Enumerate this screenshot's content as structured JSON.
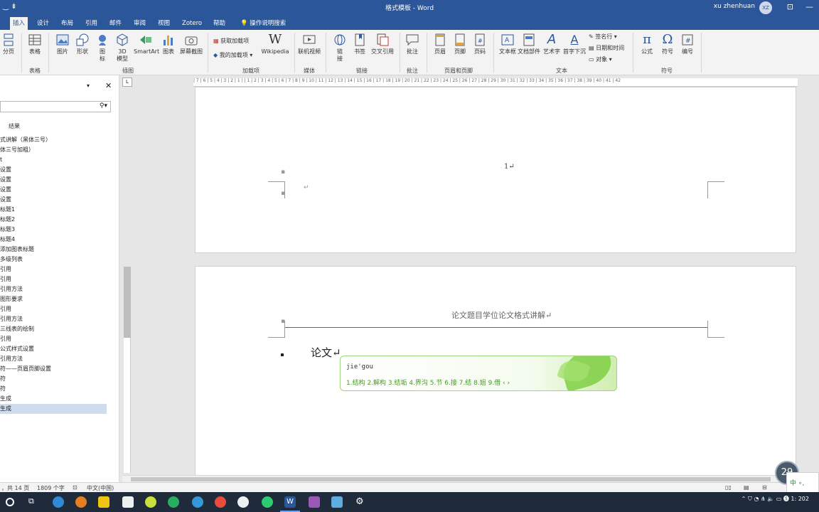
{
  "titlebar": {
    "doc_title": "格式模板  -  Word",
    "user": "xu zhenhuan",
    "avatar": "XZ",
    "save_icon": "save-icon"
  },
  "tabs": [
    "插入",
    "设计",
    "布局",
    "引用",
    "邮件",
    "审阅",
    "视图",
    "Zotero",
    "帮助",
    "操作说明搜索"
  ],
  "active_tab": "插入",
  "ribbon": {
    "buttons": {
      "page": "分页",
      "table": "表格",
      "image": "图片",
      "shape": "形状",
      "icon": "图\n标",
      "model3d": "3D\n模型",
      "smartart": "SmartArt",
      "chart": "图表",
      "screenshot": "屏幕截图",
      "get_addins": "获取加载项",
      "my_addins": "我的加载项",
      "wikipedia": "Wikipedia",
      "online_video": "联机视频",
      "link": "链\n接",
      "bookmark": "书签",
      "cross_ref": "交叉引用",
      "comment": "批注",
      "header": "页眉",
      "footer": "页脚",
      "page_number": "页码",
      "textbox": "文本框",
      "quick_parts": "文档部件",
      "wordart": "艺术字",
      "dropcap": "首字下沉",
      "signature": "签名行",
      "datetime": "日期和时间",
      "object": "对象",
      "equation": "公式",
      "symbol": "符号",
      "numbering": "编号"
    },
    "groups": {
      "tables": "表格",
      "illustrations": "插图",
      "addins": "加载项",
      "media": "媒体",
      "links": "链接",
      "comments": "批注",
      "header_footer": "页眉和页脚",
      "text": "文本",
      "symbols": "符号"
    }
  },
  "navpane": {
    "result_tab": "结果",
    "items": [
      "式讲解（黑体三号）",
      "体三号加粗）",
      "t",
      "设置",
      "设置",
      "设置",
      "设置",
      "标题1",
      "标题2",
      "标题3",
      "标题4",
      "添加图表标题",
      "多级列表",
      "引用",
      "引用",
      "引用方法",
      "图形要求",
      "引用",
      "引用方法",
      "三线表的绘制",
      "引用",
      "公式样式设置",
      "引用方法",
      "符——页眉页脚设置",
      "符",
      "符",
      "生成",
      "生成"
    ]
  },
  "ruler": {
    "numbers": "| 7 | 6 | 5 | 4 | 3 | 2 | 1 |  | 1 | 2 | 3 | 4 | 5 | 6 | 7 | 8 | 9 | 10 | 11 | 12 | 13 | 14 | 15 | 16 | 17 | 18 | 19 | 20 | 21 | 22 | 23 | 24 | 25 | 26 | 27 | 28 | 29 | 30 | 31 | 32 | 33 | 34 | 35 | 36 | 37 | 38 | 39 | 40 | 41 | 42",
    "corner": "L"
  },
  "document": {
    "page1_number": "1↵",
    "page1_return": "↵",
    "header_text": "论文题目学位论文格式讲解↵",
    "body_text": "论文↵"
  },
  "ime": {
    "composition": "jie'gou",
    "candidates": "1.结构  2.解构  3.结垢  4.界沟  5.节  6.接  7.结  8.姐  9.借  ‹ ›"
  },
  "statusbar": {
    "page_info": "，共 14 页",
    "word_count": "1809 个字",
    "language": "中文(中国)"
  },
  "float_ring": "29",
  "ime_indicator": "中 ∘,",
  "tray": {
    "time": "1:",
    "date": "202"
  },
  "colors": {
    "word_blue": "#2b579a",
    "ime_green": "#4a9a2a",
    "taskbar": "#1f2b3a"
  }
}
